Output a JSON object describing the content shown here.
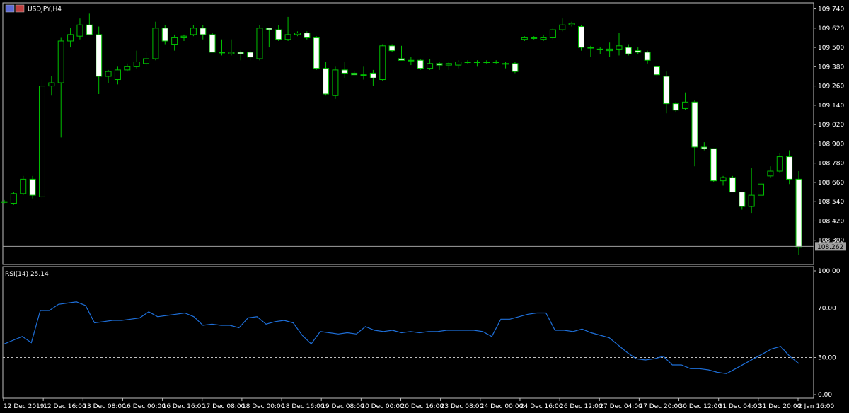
{
  "window": {
    "symbol_title": "USDJPY,H4",
    "rsi_title": "RSI(14) 25.14"
  },
  "colors": {
    "background": "#000000",
    "frame": "#c0c0c0",
    "bull_candle": "#00c000",
    "bear_candle_fill": "#ffffff",
    "wick": "#00c000",
    "rsi_line": "#1e6fd9",
    "bid_line": "#a0a0a0",
    "price_label_bg": "#a0a0a0"
  },
  "chart_data": [
    {
      "type": "candlestick",
      "title": "USDJPY,H4",
      "ylim": [
        108.18,
        109.76
      ],
      "y_ticks": [
        "109.740",
        "109.620",
        "109.500",
        "109.380",
        "109.260",
        "109.140",
        "109.020",
        "108.900",
        "108.780",
        "108.660",
        "108.540",
        "108.420",
        "108.300"
      ],
      "current_price": "108.262",
      "candles": [
        {
          "o": 108.54,
          "h": 108.55,
          "l": 108.53,
          "c": 108.54
        },
        {
          "o": 108.53,
          "h": 108.6,
          "l": 108.52,
          "c": 108.59
        },
        {
          "o": 108.59,
          "h": 108.7,
          "l": 108.58,
          "c": 108.68
        },
        {
          "o": 108.68,
          "h": 108.7,
          "l": 108.56,
          "c": 108.58
        },
        {
          "o": 108.57,
          "h": 109.3,
          "l": 108.56,
          "c": 109.26
        },
        {
          "o": 109.26,
          "h": 109.32,
          "l": 109.2,
          "c": 109.28
        },
        {
          "o": 109.28,
          "h": 109.56,
          "l": 108.94,
          "c": 109.54
        },
        {
          "o": 109.54,
          "h": 109.62,
          "l": 109.5,
          "c": 109.58
        },
        {
          "o": 109.57,
          "h": 109.68,
          "l": 109.55,
          "c": 109.64
        },
        {
          "o": 109.64,
          "h": 109.71,
          "l": 109.58,
          "c": 109.58
        },
        {
          "o": 109.58,
          "h": 109.63,
          "l": 109.21,
          "c": 109.32
        },
        {
          "o": 109.32,
          "h": 109.36,
          "l": 109.28,
          "c": 109.35
        },
        {
          "o": 109.3,
          "h": 109.38,
          "l": 109.27,
          "c": 109.36
        },
        {
          "o": 109.36,
          "h": 109.4,
          "l": 109.35,
          "c": 109.38
        },
        {
          "o": 109.38,
          "h": 109.48,
          "l": 109.37,
          "c": 109.41
        },
        {
          "o": 109.4,
          "h": 109.47,
          "l": 109.38,
          "c": 109.43
        },
        {
          "o": 109.43,
          "h": 109.66,
          "l": 109.42,
          "c": 109.62
        },
        {
          "o": 109.62,
          "h": 109.64,
          "l": 109.52,
          "c": 109.54
        },
        {
          "o": 109.52,
          "h": 109.58,
          "l": 109.48,
          "c": 109.56
        },
        {
          "o": 109.56,
          "h": 109.58,
          "l": 109.54,
          "c": 109.57
        },
        {
          "o": 109.58,
          "h": 109.64,
          "l": 109.57,
          "c": 109.62
        },
        {
          "o": 109.62,
          "h": 109.64,
          "l": 109.55,
          "c": 109.58
        },
        {
          "o": 109.58,
          "h": 109.59,
          "l": 109.47,
          "c": 109.47
        },
        {
          "o": 109.47,
          "h": 109.55,
          "l": 109.45,
          "c": 109.47
        },
        {
          "o": 109.46,
          "h": 109.55,
          "l": 109.45,
          "c": 109.47
        },
        {
          "o": 109.47,
          "h": 109.48,
          "l": 109.42,
          "c": 109.46
        },
        {
          "o": 109.47,
          "h": 109.48,
          "l": 109.42,
          "c": 109.44
        },
        {
          "o": 109.43,
          "h": 109.64,
          "l": 109.42,
          "c": 109.62
        },
        {
          "o": 109.62,
          "h": 109.62,
          "l": 109.5,
          "c": 109.61
        },
        {
          "o": 109.61,
          "h": 109.64,
          "l": 109.54,
          "c": 109.55
        },
        {
          "o": 109.55,
          "h": 109.69,
          "l": 109.54,
          "c": 109.58
        },
        {
          "o": 109.58,
          "h": 109.6,
          "l": 109.57,
          "c": 109.59
        },
        {
          "o": 109.59,
          "h": 109.6,
          "l": 109.55,
          "c": 109.56
        },
        {
          "o": 109.56,
          "h": 109.57,
          "l": 109.36,
          "c": 109.37
        },
        {
          "o": 109.37,
          "h": 109.41,
          "l": 109.2,
          "c": 109.21
        },
        {
          "o": 109.2,
          "h": 109.38,
          "l": 109.18,
          "c": 109.36
        },
        {
          "o": 109.36,
          "h": 109.41,
          "l": 109.31,
          "c": 109.34
        },
        {
          "o": 109.34,
          "h": 109.35,
          "l": 109.33,
          "c": 109.33
        },
        {
          "o": 109.33,
          "h": 109.38,
          "l": 109.3,
          "c": 109.33
        },
        {
          "o": 109.34,
          "h": 109.36,
          "l": 109.26,
          "c": 109.31
        },
        {
          "o": 109.3,
          "h": 109.52,
          "l": 109.29,
          "c": 109.51
        },
        {
          "o": 109.51,
          "h": 109.52,
          "l": 109.47,
          "c": 109.48
        },
        {
          "o": 109.43,
          "h": 109.51,
          "l": 109.42,
          "c": 109.42
        },
        {
          "o": 109.42,
          "h": 109.44,
          "l": 109.39,
          "c": 109.42
        },
        {
          "o": 109.42,
          "h": 109.43,
          "l": 109.36,
          "c": 109.37
        },
        {
          "o": 109.37,
          "h": 109.43,
          "l": 109.36,
          "c": 109.4
        },
        {
          "o": 109.4,
          "h": 109.41,
          "l": 109.36,
          "c": 109.39
        },
        {
          "o": 109.39,
          "h": 109.41,
          "l": 109.36,
          "c": 109.4
        },
        {
          "o": 109.39,
          "h": 109.42,
          "l": 109.37,
          "c": 109.41
        },
        {
          "o": 109.41,
          "h": 109.42,
          "l": 109.4,
          "c": 109.41
        },
        {
          "o": 109.41,
          "h": 109.42,
          "l": 109.38,
          "c": 109.41
        },
        {
          "o": 109.41,
          "h": 109.42,
          "l": 109.4,
          "c": 109.41
        },
        {
          "o": 109.41,
          "h": 109.42,
          "l": 109.4,
          "c": 109.41
        },
        {
          "o": 109.4,
          "h": 109.41,
          "l": 109.37,
          "c": 109.4
        },
        {
          "o": 109.4,
          "h": 109.41,
          "l": 109.34,
          "c": 109.35
        },
        {
          "o": 109.55,
          "h": 109.57,
          "l": 109.54,
          "c": 109.56
        },
        {
          "o": 109.56,
          "h": 109.57,
          "l": 109.55,
          "c": 109.56
        },
        {
          "o": 109.55,
          "h": 109.58,
          "l": 109.54,
          "c": 109.56
        },
        {
          "o": 109.56,
          "h": 109.62,
          "l": 109.55,
          "c": 109.61
        },
        {
          "o": 109.61,
          "h": 109.68,
          "l": 109.6,
          "c": 109.64
        },
        {
          "o": 109.64,
          "h": 109.66,
          "l": 109.63,
          "c": 109.65
        },
        {
          "o": 109.63,
          "h": 109.64,
          "l": 109.48,
          "c": 109.5
        },
        {
          "o": 109.5,
          "h": 109.51,
          "l": 109.44,
          "c": 109.5
        },
        {
          "o": 109.49,
          "h": 109.5,
          "l": 109.46,
          "c": 109.49
        },
        {
          "o": 109.48,
          "h": 109.53,
          "l": 109.44,
          "c": 109.49
        },
        {
          "o": 109.49,
          "h": 109.59,
          "l": 109.45,
          "c": 109.51
        },
        {
          "o": 109.5,
          "h": 109.52,
          "l": 109.45,
          "c": 109.46
        },
        {
          "o": 109.48,
          "h": 109.5,
          "l": 109.46,
          "c": 109.47
        },
        {
          "o": 109.47,
          "h": 109.48,
          "l": 109.4,
          "c": 109.42
        },
        {
          "o": 109.38,
          "h": 109.39,
          "l": 109.31,
          "c": 109.33
        },
        {
          "o": 109.32,
          "h": 109.35,
          "l": 109.09,
          "c": 109.15
        },
        {
          "o": 109.15,
          "h": 109.16,
          "l": 109.1,
          "c": 109.11
        },
        {
          "o": 109.12,
          "h": 109.22,
          "l": 109.11,
          "c": 109.16
        },
        {
          "o": 109.16,
          "h": 109.17,
          "l": 108.76,
          "c": 108.88
        },
        {
          "o": 108.88,
          "h": 108.91,
          "l": 108.86,
          "c": 108.87
        },
        {
          "o": 108.87,
          "h": 108.87,
          "l": 108.66,
          "c": 108.67
        },
        {
          "o": 108.67,
          "h": 108.7,
          "l": 108.64,
          "c": 108.69
        },
        {
          "o": 108.69,
          "h": 108.7,
          "l": 108.6,
          "c": 108.6
        },
        {
          "o": 108.6,
          "h": 108.6,
          "l": 108.49,
          "c": 108.51
        },
        {
          "o": 108.51,
          "h": 108.75,
          "l": 108.47,
          "c": 108.58
        },
        {
          "o": 108.58,
          "h": 108.66,
          "l": 108.57,
          "c": 108.65
        },
        {
          "o": 108.7,
          "h": 108.76,
          "l": 108.69,
          "c": 108.73
        },
        {
          "o": 108.73,
          "h": 108.84,
          "l": 108.72,
          "c": 108.82
        },
        {
          "o": 108.82,
          "h": 108.86,
          "l": 108.65,
          "c": 108.68
        },
        {
          "o": 108.68,
          "h": 108.73,
          "l": 108.21,
          "c": 108.26
        }
      ]
    },
    {
      "type": "line",
      "title": "RSI(14) 25.14",
      "ylim": [
        0,
        100
      ],
      "y_ticks": [
        "100.00",
        "70.00",
        "30.00",
        "0.00"
      ],
      "levels": [
        70,
        30
      ],
      "series": [
        {
          "name": "RSI(14)",
          "values": [
            41,
            44,
            47,
            42,
            68,
            68,
            73,
            74,
            75,
            72,
            58,
            59,
            60,
            60,
            61,
            62,
            67,
            63,
            64,
            65,
            66,
            63,
            56,
            57,
            56,
            56,
            54,
            62,
            63,
            57,
            59,
            60,
            58,
            48,
            41,
            51,
            50,
            49,
            50,
            49,
            55,
            52,
            51,
            52,
            50,
            51,
            50,
            51,
            51,
            52,
            52,
            52,
            52,
            51,
            47,
            61,
            61,
            63,
            65,
            66,
            66,
            52,
            52,
            51,
            53,
            50,
            48,
            46,
            40,
            34,
            29,
            28,
            29,
            31,
            24,
            24,
            21,
            21,
            20,
            18,
            17,
            21,
            25,
            29,
            33,
            37,
            39,
            31,
            25.14
          ]
        }
      ],
      "x_ticks": [
        "12 Dec 2019",
        "12 Dec 16:00",
        "13 Dec 08:00",
        "16 Dec 00:00",
        "16 Dec 16:00",
        "17 Dec 08:00",
        "18 Dec 00:00",
        "18 Dec 16:00",
        "19 Dec 08:00",
        "20 Dec 00:00",
        "20 Dec 16:00",
        "23 Dec 08:00",
        "24 Dec 00:00",
        "24 Dec 16:00",
        "26 Dec 12:00",
        "27 Dec 04:00",
        "27 Dec 20:00",
        "30 Dec 12:00",
        "31 Dec 04:00",
        "31 Dec 20:00",
        "2 Jan 16:00"
      ]
    }
  ]
}
